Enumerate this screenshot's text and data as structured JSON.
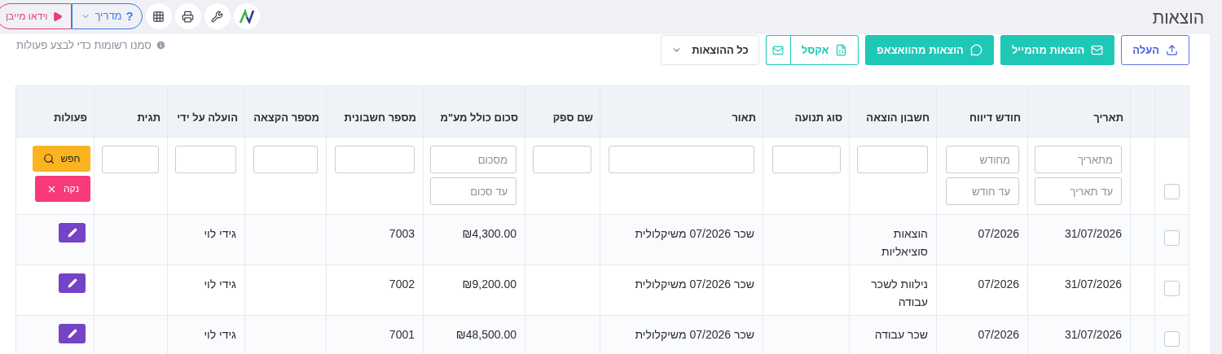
{
  "top_bar": {
    "video_button": "וידאו מייבן",
    "guide_button": {
      "icon_char": "?",
      "label": "מדריך"
    }
  },
  "title": "הוצאות",
  "toolbar": {
    "buttons": [
      {
        "kind": "upload",
        "label": "העלה"
      },
      {
        "kind": "mail",
        "label": "הוצאות מהמייל"
      },
      {
        "kind": "whatsapp",
        "label": "הוצאות מהוואצאפ"
      },
      {
        "kind": "excel",
        "label": "אקסל"
      },
      {
        "kind": "dropdown",
        "label": "כל ההוצאות"
      }
    ],
    "hint": "סמנו רשומות כדי לבצע פעולות"
  },
  "table": {
    "select_all": {
      "checked": false
    },
    "columns": [
      {
        "label": "תאריך",
        "filters": [
          {
            "placeholder": "מתאריך"
          },
          {
            "placeholder": "עד תאריך"
          }
        ]
      },
      {
        "label": "חודש דיווח",
        "filters": [
          {
            "placeholder": "מחודש"
          },
          {
            "placeholder": "עד חודש"
          }
        ]
      },
      {
        "label": "חשבון הוצאה",
        "filters": [
          {
            "kind": "input"
          }
        ]
      },
      {
        "label": "סוג תנועה",
        "filters": [
          {
            "kind": "input"
          }
        ]
      },
      {
        "label": "תאור",
        "filters": [
          {
            "kind": "input"
          }
        ]
      },
      {
        "label": "שם ספק",
        "filters": [
          {
            "kind": "input"
          }
        ]
      },
      {
        "label": "סכום כולל מע\"מ",
        "filters": [
          {
            "placeholder": "מסכום"
          },
          {
            "placeholder": "עד סכום"
          }
        ]
      },
      {
        "label": "מספר חשבונית",
        "filters": [
          {
            "kind": "input"
          }
        ]
      },
      {
        "label": "מספר הקצאה",
        "filters": [
          {
            "kind": "input"
          }
        ]
      },
      {
        "label": "הועלה על ידי",
        "filters": [
          {
            "kind": "input"
          }
        ]
      },
      {
        "label": "תגית",
        "filters": [
          {
            "kind": "input"
          }
        ]
      },
      {
        "label": "פעולות"
      }
    ],
    "search_button": "חפש",
    "clear_button": "נקה",
    "rows": [
      {
        "selected": false,
        "date": "31/07/2026",
        "report_month": "07/2026",
        "expense_account": "הוצאות סוציאליות",
        "description": "שכר 07/2026 משיקלולית",
        "amount": "₪4,300.00",
        "invoice_number": "7003",
        "uploaded_by": "גידי לוי"
      },
      {
        "selected": false,
        "date": "31/07/2026",
        "report_month": "07/2026",
        "expense_account": "נילוות לשכר עבודה",
        "description": "שכר 07/2026 משיקלולית",
        "amount": "₪9,200.00",
        "invoice_number": "7002",
        "uploaded_by": "גידי לוי"
      },
      {
        "selected": false,
        "date": "31/07/2026",
        "report_month": "07/2026",
        "expense_account": "שכר עבודה",
        "description": "שכר 07/2026 משיקלולית",
        "amount": "₪48,500.00",
        "invoice_number": "7001",
        "uploaded_by": "גידי לוי"
      }
    ]
  }
}
